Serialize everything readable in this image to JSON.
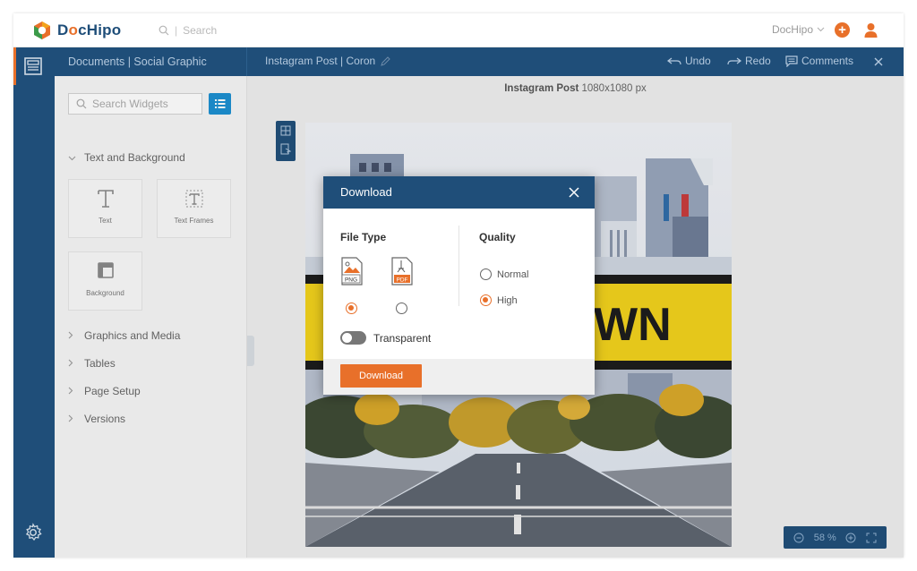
{
  "topbar": {
    "logo": "DocHipo",
    "search_placeholder": "Search",
    "account": "DocHipo"
  },
  "panel": {
    "breadcrumb": "Documents | Social Graphic",
    "search_placeholder": "Search Widgets",
    "sections": {
      "text_background": "Text and Background",
      "graphics_media": "Graphics and Media",
      "tables": "Tables",
      "page_setup": "Page Setup",
      "versions": "Versions"
    },
    "tiles": {
      "text": "Text",
      "text_frames": "Text Frames",
      "background": "Background"
    }
  },
  "editor": {
    "doc_name": "Instagram Post | Coron",
    "undo": "Undo",
    "redo": "Redo",
    "comments": "Comments",
    "canvas_title": "Instagram Post",
    "canvas_size": "1080x1080 px",
    "artwork_text": "WN",
    "zoom_value": "58",
    "zoom_unit": "%"
  },
  "modal": {
    "title": "Download",
    "file_type_label": "File Type",
    "png_tag": "PNG",
    "pdf_tag": "PDF",
    "quality_label": "Quality",
    "quality_normal": "Normal",
    "quality_high": "High",
    "transparent_label": "Transparent",
    "download_button": "Download",
    "selected_file_type": "PNG",
    "selected_quality": "High",
    "transparent_on": false
  },
  "colors": {
    "brand_navy": "#1f4e79",
    "accent_orange": "#e8702a",
    "panel_bg": "#f6f6f6",
    "banner_yellow": "#f2d21b"
  }
}
